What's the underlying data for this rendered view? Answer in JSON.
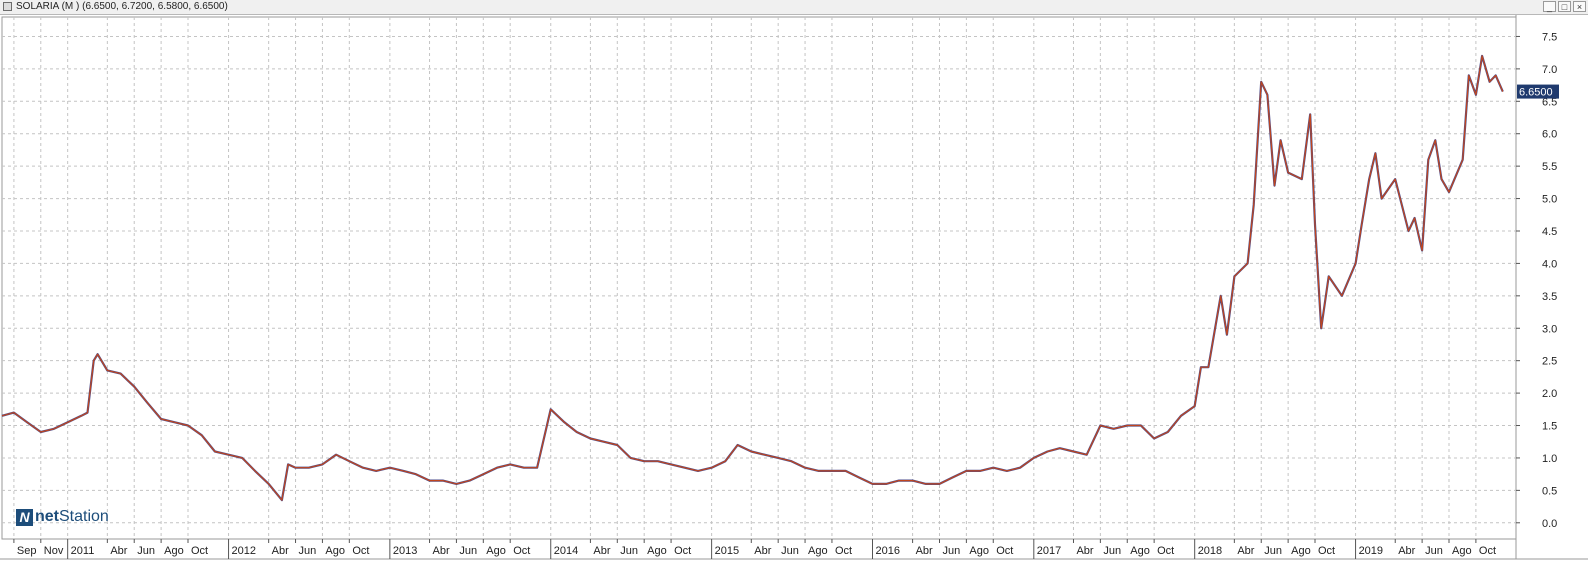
{
  "window": {
    "title": "SOLARIA (M ) (6.6500, 6.7200, 6.5800, 6.6500)",
    "buttons": [
      "_",
      "□",
      "×"
    ]
  },
  "logo": {
    "text_bold": "net",
    "text_regular": "Station"
  },
  "colors": {
    "background": "#ffffff",
    "grid": "#c4c4c4",
    "price_line": "#c0451e",
    "price_line_alt": "#2c2f7a",
    "last_label_bg": "#1f3a6e",
    "last_label_fg": "#ffffff"
  },
  "chart_data": {
    "type": "line",
    "title": "",
    "xlabel": "",
    "ylabel": "",
    "ylim": [
      -0.25,
      7.8
    ],
    "yticks": [
      0.0,
      0.5,
      1.0,
      1.5,
      2.0,
      2.5,
      3.0,
      3.5,
      4.0,
      4.5,
      5.0,
      5.5,
      6.0,
      6.5,
      7.0,
      7.5
    ],
    "ytick_labels": [
      "0.0",
      "0.5",
      "1.0",
      "1.5",
      "2.0",
      "2.5",
      "3.0",
      "3.5",
      "4.0",
      "4.5",
      "5.0",
      "5.5",
      "6.0",
      "6.5",
      "7.0",
      "7.5"
    ],
    "xlim": [
      "2010-08-05",
      "2019-12-31"
    ],
    "xticks": [
      {
        "date": "2010-09-01",
        "label": "Sep"
      },
      {
        "date": "2010-11-01",
        "label": "Nov"
      },
      {
        "date": "2011-01-01",
        "label": "2011",
        "year": true
      },
      {
        "date": "2011-04-01",
        "label": "Abr"
      },
      {
        "date": "2011-06-01",
        "label": "Jun"
      },
      {
        "date": "2011-08-01",
        "label": "Ago"
      },
      {
        "date": "2011-10-01",
        "label": "Oct"
      },
      {
        "date": "2012-01-01",
        "label": "2012",
        "year": true
      },
      {
        "date": "2012-04-01",
        "label": "Abr"
      },
      {
        "date": "2012-06-01",
        "label": "Jun"
      },
      {
        "date": "2012-08-01",
        "label": "Ago"
      },
      {
        "date": "2012-10-01",
        "label": "Oct"
      },
      {
        "date": "2013-01-01",
        "label": "2013",
        "year": true
      },
      {
        "date": "2013-04-01",
        "label": "Abr"
      },
      {
        "date": "2013-06-01",
        "label": "Jun"
      },
      {
        "date": "2013-08-01",
        "label": "Ago"
      },
      {
        "date": "2013-10-01",
        "label": "Oct"
      },
      {
        "date": "2014-01-01",
        "label": "2014",
        "year": true
      },
      {
        "date": "2014-04-01",
        "label": "Abr"
      },
      {
        "date": "2014-06-01",
        "label": "Jun"
      },
      {
        "date": "2014-08-01",
        "label": "Ago"
      },
      {
        "date": "2014-10-01",
        "label": "Oct"
      },
      {
        "date": "2015-01-01",
        "label": "2015",
        "year": true
      },
      {
        "date": "2015-04-01",
        "label": "Abr"
      },
      {
        "date": "2015-06-01",
        "label": "Jun"
      },
      {
        "date": "2015-08-01",
        "label": "Ago"
      },
      {
        "date": "2015-10-01",
        "label": "Oct"
      },
      {
        "date": "2016-01-01",
        "label": "2016",
        "year": true
      },
      {
        "date": "2016-04-01",
        "label": "Abr"
      },
      {
        "date": "2016-06-01",
        "label": "Jun"
      },
      {
        "date": "2016-08-01",
        "label": "Ago"
      },
      {
        "date": "2016-10-01",
        "label": "Oct"
      },
      {
        "date": "2017-01-01",
        "label": "2017",
        "year": true
      },
      {
        "date": "2017-04-01",
        "label": "Abr"
      },
      {
        "date": "2017-06-01",
        "label": "Jun"
      },
      {
        "date": "2017-08-01",
        "label": "Ago"
      },
      {
        "date": "2017-10-01",
        "label": "Oct"
      },
      {
        "date": "2018-01-01",
        "label": "2018",
        "year": true
      },
      {
        "date": "2018-04-01",
        "label": "Abr"
      },
      {
        "date": "2018-06-01",
        "label": "Jun"
      },
      {
        "date": "2018-08-01",
        "label": "Ago"
      },
      {
        "date": "2018-10-01",
        "label": "Oct"
      },
      {
        "date": "2019-01-01",
        "label": "2019",
        "year": true
      },
      {
        "date": "2019-04-01",
        "label": "Abr"
      },
      {
        "date": "2019-06-01",
        "label": "Jun"
      },
      {
        "date": "2019-08-01",
        "label": "Ago"
      },
      {
        "date": "2019-10-01",
        "label": "Oct"
      }
    ],
    "grid": true,
    "last_value": "6.6500",
    "series": [
      {
        "points": [
          [
            "2010-08-05",
            1.65
          ],
          [
            "2010-09-01",
            1.7
          ],
          [
            "2010-10-01",
            1.55
          ],
          [
            "2010-11-01",
            1.4
          ],
          [
            "2010-12-01",
            1.45
          ],
          [
            "2011-01-01",
            1.55
          ],
          [
            "2011-02-01",
            1.65
          ],
          [
            "2011-02-15",
            1.7
          ],
          [
            "2011-03-01",
            2.5
          ],
          [
            "2011-03-10",
            2.6
          ],
          [
            "2011-04-01",
            2.35
          ],
          [
            "2011-05-01",
            2.3
          ],
          [
            "2011-06-01",
            2.1
          ],
          [
            "2011-07-01",
            1.85
          ],
          [
            "2011-08-01",
            1.6
          ],
          [
            "2011-09-01",
            1.55
          ],
          [
            "2011-10-01",
            1.5
          ],
          [
            "2011-11-01",
            1.35
          ],
          [
            "2011-12-01",
            1.1
          ],
          [
            "2012-01-01",
            1.05
          ],
          [
            "2012-02-01",
            1.0
          ],
          [
            "2012-03-01",
            0.8
          ],
          [
            "2012-04-01",
            0.6
          ],
          [
            "2012-05-01",
            0.35
          ],
          [
            "2012-05-15",
            0.9
          ],
          [
            "2012-06-01",
            0.85
          ],
          [
            "2012-07-01",
            0.85
          ],
          [
            "2012-08-01",
            0.9
          ],
          [
            "2012-09-01",
            1.05
          ],
          [
            "2012-10-01",
            0.95
          ],
          [
            "2012-11-01",
            0.85
          ],
          [
            "2012-12-01",
            0.8
          ],
          [
            "2013-01-01",
            0.85
          ],
          [
            "2013-02-01",
            0.8
          ],
          [
            "2013-03-01",
            0.75
          ],
          [
            "2013-04-01",
            0.65
          ],
          [
            "2013-05-01",
            0.65
          ],
          [
            "2013-06-01",
            0.6
          ],
          [
            "2013-07-01",
            0.65
          ],
          [
            "2013-08-01",
            0.75
          ],
          [
            "2013-09-01",
            0.85
          ],
          [
            "2013-10-01",
            0.9
          ],
          [
            "2013-11-01",
            0.85
          ],
          [
            "2013-12-01",
            0.85
          ],
          [
            "2014-01-01",
            1.75
          ],
          [
            "2014-02-01",
            1.55
          ],
          [
            "2014-03-01",
            1.4
          ],
          [
            "2014-04-01",
            1.3
          ],
          [
            "2014-05-01",
            1.25
          ],
          [
            "2014-06-01",
            1.2
          ],
          [
            "2014-07-01",
            1.0
          ],
          [
            "2014-08-01",
            0.95
          ],
          [
            "2014-09-01",
            0.95
          ],
          [
            "2014-10-01",
            0.9
          ],
          [
            "2014-11-01",
            0.85
          ],
          [
            "2014-12-01",
            0.8
          ],
          [
            "2015-01-01",
            0.85
          ],
          [
            "2015-02-01",
            0.95
          ],
          [
            "2015-03-01",
            1.2
          ],
          [
            "2015-04-01",
            1.1
          ],
          [
            "2015-05-01",
            1.05
          ],
          [
            "2015-06-01",
            1.0
          ],
          [
            "2015-07-01",
            0.95
          ],
          [
            "2015-08-01",
            0.85
          ],
          [
            "2015-09-01",
            0.8
          ],
          [
            "2015-10-01",
            0.8
          ],
          [
            "2015-11-01",
            0.8
          ],
          [
            "2015-12-01",
            0.7
          ],
          [
            "2016-01-01",
            0.6
          ],
          [
            "2016-02-01",
            0.6
          ],
          [
            "2016-03-01",
            0.65
          ],
          [
            "2016-04-01",
            0.65
          ],
          [
            "2016-05-01",
            0.6
          ],
          [
            "2016-06-01",
            0.6
          ],
          [
            "2016-07-01",
            0.7
          ],
          [
            "2016-08-01",
            0.8
          ],
          [
            "2016-09-01",
            0.8
          ],
          [
            "2016-10-01",
            0.85
          ],
          [
            "2016-11-01",
            0.8
          ],
          [
            "2016-12-01",
            0.85
          ],
          [
            "2017-01-01",
            1.0
          ],
          [
            "2017-02-01",
            1.1
          ],
          [
            "2017-03-01",
            1.15
          ],
          [
            "2017-04-01",
            1.1
          ],
          [
            "2017-05-01",
            1.05
          ],
          [
            "2017-06-01",
            1.5
          ],
          [
            "2017-07-01",
            1.45
          ],
          [
            "2017-08-01",
            1.5
          ],
          [
            "2017-09-01",
            1.5
          ],
          [
            "2017-10-01",
            1.3
          ],
          [
            "2017-11-01",
            1.4
          ],
          [
            "2017-12-01",
            1.65
          ],
          [
            "2018-01-01",
            1.8
          ],
          [
            "2018-01-15",
            2.4
          ],
          [
            "2018-02-01",
            2.4
          ],
          [
            "2018-03-01",
            3.5
          ],
          [
            "2018-03-15",
            2.9
          ],
          [
            "2018-04-01",
            3.8
          ],
          [
            "2018-05-01",
            4.0
          ],
          [
            "2018-05-15",
            4.9
          ],
          [
            "2018-06-01",
            6.8
          ],
          [
            "2018-06-15",
            6.6
          ],
          [
            "2018-07-01",
            5.2
          ],
          [
            "2018-07-15",
            5.9
          ],
          [
            "2018-08-01",
            5.4
          ],
          [
            "2018-09-01",
            5.3
          ],
          [
            "2018-09-20",
            6.3
          ],
          [
            "2018-10-01",
            4.6
          ],
          [
            "2018-10-15",
            3.0
          ],
          [
            "2018-11-01",
            3.8
          ],
          [
            "2018-12-01",
            3.5
          ],
          [
            "2019-01-01",
            4.0
          ],
          [
            "2019-01-15",
            4.6
          ],
          [
            "2019-02-01",
            5.3
          ],
          [
            "2019-02-15",
            5.7
          ],
          [
            "2019-03-01",
            5.0
          ],
          [
            "2019-04-01",
            5.3
          ],
          [
            "2019-05-01",
            4.5
          ],
          [
            "2019-05-15",
            4.7
          ],
          [
            "2019-06-01",
            4.2
          ],
          [
            "2019-06-15",
            5.6
          ],
          [
            "2019-07-01",
            5.9
          ],
          [
            "2019-07-15",
            5.3
          ],
          [
            "2019-08-01",
            5.1
          ],
          [
            "2019-09-01",
            5.6
          ],
          [
            "2019-09-15",
            6.9
          ],
          [
            "2019-10-01",
            6.6
          ],
          [
            "2019-10-15",
            7.2
          ],
          [
            "2019-11-01",
            6.8
          ],
          [
            "2019-11-15",
            6.9
          ],
          [
            "2019-12-01",
            6.65
          ]
        ]
      }
    ]
  }
}
